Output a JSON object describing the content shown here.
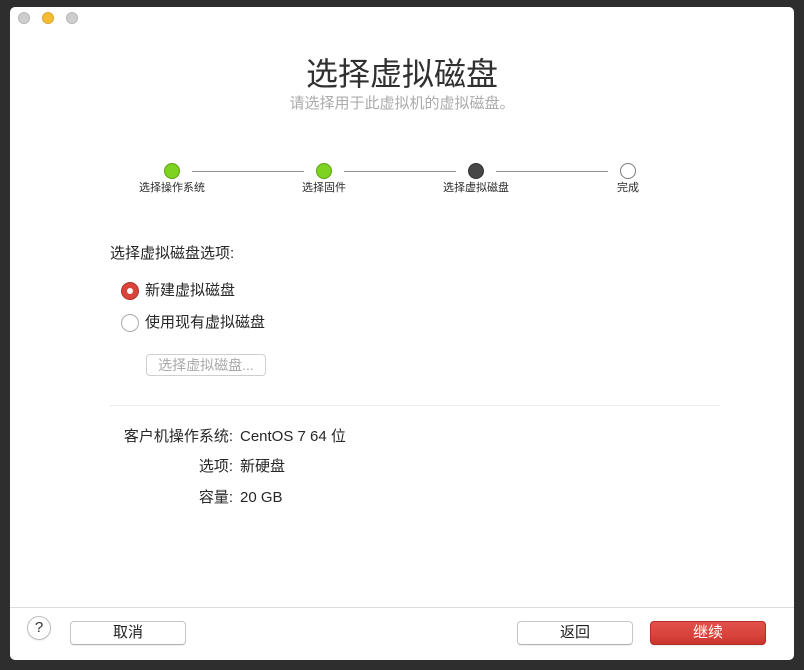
{
  "colors": {
    "frame": "#2e2e2e",
    "window_bg": "#ffffff",
    "accent": "#d8433b",
    "step_done": "#7ed321",
    "step_active": "#474747",
    "close_button": "#cdcdcd",
    "minimize_button": "#f5bd33",
    "zoom_button": "#cdcdcd"
  },
  "header": {
    "title": "选择虚拟磁盘",
    "subtitle": "请选择用于此虚拟机的虚拟磁盘。"
  },
  "steps": [
    {
      "label": "选择操作系统",
      "completed": true,
      "active": false
    },
    {
      "label": "选择固件",
      "completed": true,
      "active": false
    },
    {
      "label": "选择虚拟磁盘",
      "completed": false,
      "active": true
    },
    {
      "label": "完成",
      "completed": false,
      "active": false
    }
  ],
  "disk_options": {
    "heading": "选择虚拟磁盘选项:",
    "choices": [
      {
        "label": "新建虚拟磁盘",
        "checked": true
      },
      {
        "label": "使用现有虚拟磁盘",
        "checked": false
      }
    ],
    "choose_disk_button": {
      "label": "选择虚拟磁盘...",
      "disabled": true
    }
  },
  "summary": [
    {
      "label": "客户机操作系统:",
      "value": "CentOS 7 64 位"
    },
    {
      "label": "选项:",
      "value": "新硬盘"
    },
    {
      "label": "容量:",
      "value": "20 GB"
    }
  ],
  "footer": {
    "help_label": "?",
    "cancel_label": "取消",
    "back_label": "返回",
    "continue_label": "继续"
  }
}
